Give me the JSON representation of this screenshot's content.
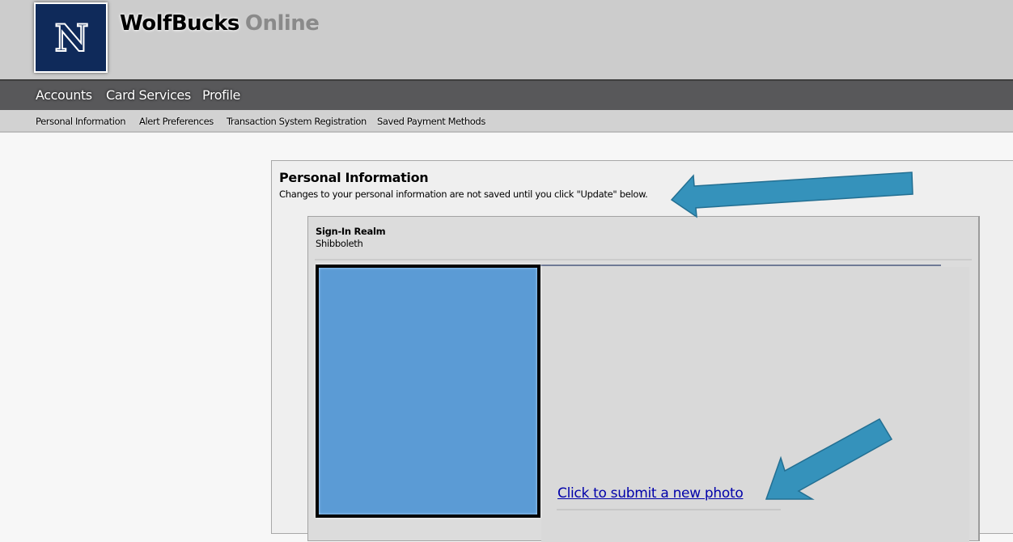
{
  "header": {
    "logo_letter": "N",
    "brand_main": "WolfBucks",
    "brand_sub": "Online"
  },
  "nav": {
    "items": [
      {
        "label": "Accounts"
      },
      {
        "label": "Card Services"
      },
      {
        "label": "Profile"
      }
    ]
  },
  "subnav": {
    "items": [
      {
        "label": "Personal Information"
      },
      {
        "label": "Alert Preferences"
      },
      {
        "label": "Transaction System Registration"
      },
      {
        "label": "Saved Payment Methods"
      }
    ]
  },
  "main": {
    "title": "Personal Information",
    "description": "Changes to your personal information are not saved until you click \"Update\" below.",
    "realm_label": "Sign-In Realm",
    "realm_value": "Shibboleth",
    "photo_link": "Click to submit a new photo"
  },
  "colors": {
    "arrow": "#3592bb",
    "photo_placeholder": "#5b9bd5",
    "logo_bg": "#0f2a5a",
    "link": "#0000aa"
  }
}
